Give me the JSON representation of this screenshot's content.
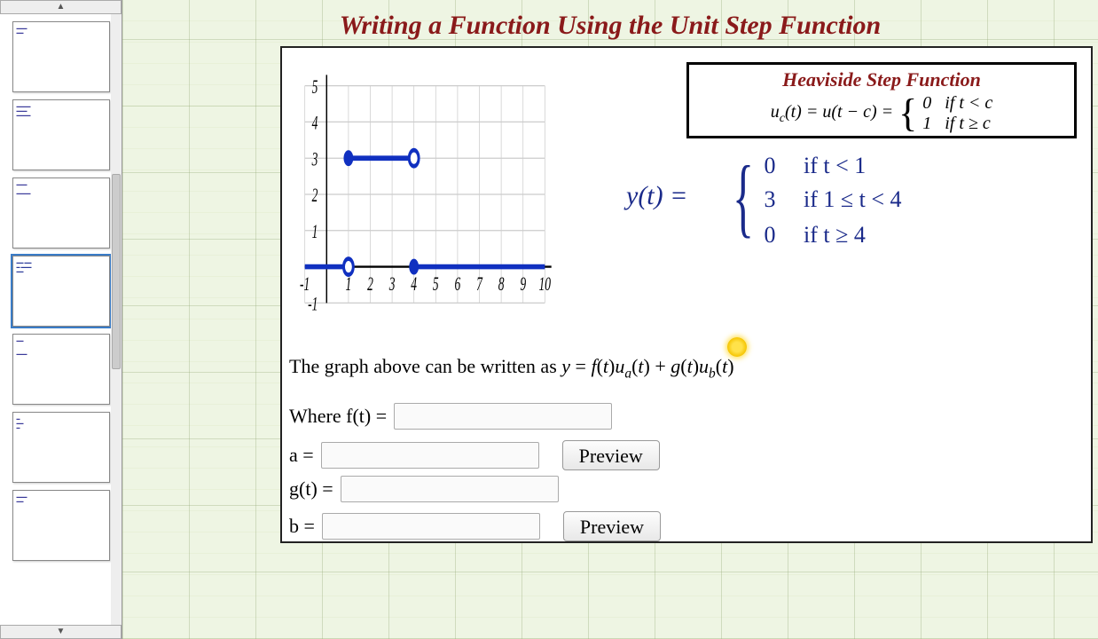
{
  "title": "Writing a Function Using the Unit Step Function",
  "heaviside": {
    "title": "Heaviside Step Function",
    "lhs": "u_c(t) = u(t − c) =",
    "row1_val": "0",
    "row1_cond": "if t < c",
    "row2_val": "1",
    "row2_cond": "if t ≥ c"
  },
  "handwritten": {
    "lhs": "y(t) =",
    "r1_val": "0",
    "r1_cond": "if  t < 1",
    "r2_val": "3",
    "r2_cond": "if  1 ≤ t < 4",
    "r3_val": "0",
    "r3_cond": "if  t ≥ 4"
  },
  "question": {
    "prefix": "The graph above can be written as ",
    "formula": "y = f(t)uₐ(t) + g(t)u_b(t)"
  },
  "inputs": {
    "where_ft": "Where f(t) =",
    "a_label": "a =",
    "gt_label": "g(t) =",
    "b_label": "b =",
    "preview": "Preview",
    "ft_value": "",
    "a_value": "",
    "gt_value": "",
    "b_value": ""
  },
  "chart_data": {
    "type": "line",
    "title": "",
    "xlabel": "",
    "ylabel": "",
    "xlim": [
      -1,
      10
    ],
    "ylim": [
      -1,
      5
    ],
    "xticks": [
      -1,
      0,
      1,
      2,
      3,
      4,
      5,
      6,
      7,
      8,
      9,
      10
    ],
    "yticks": [
      -1,
      0,
      1,
      2,
      3,
      4,
      5
    ],
    "series": [
      {
        "name": "segment1",
        "x": [
          -1,
          1
        ],
        "y": [
          0,
          0
        ],
        "left_closed": true,
        "right_closed": false
      },
      {
        "name": "segment2",
        "x": [
          1,
          4
        ],
        "y": [
          3,
          3
        ],
        "left_closed": true,
        "right_closed": false
      },
      {
        "name": "segment3",
        "x": [
          4,
          10
        ],
        "y": [
          0,
          0
        ],
        "left_closed": true,
        "right_closed": true
      }
    ],
    "markers": [
      {
        "x": 1,
        "y": 0,
        "type": "open"
      },
      {
        "x": 1,
        "y": 3,
        "type": "closed"
      },
      {
        "x": 4,
        "y": 3,
        "type": "open"
      },
      {
        "x": 4,
        "y": 0,
        "type": "closed"
      }
    ]
  },
  "thumbnails": {
    "count": 7,
    "selected_index": 3
  }
}
